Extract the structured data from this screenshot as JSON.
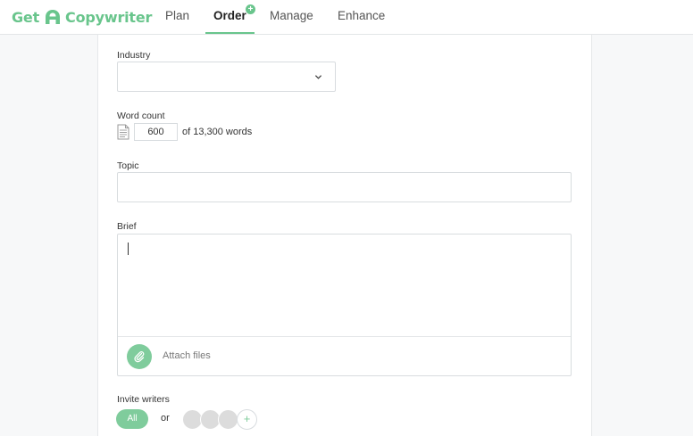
{
  "brand": {
    "name_part1": "Get",
    "name_part2": "Copywriter",
    "accent": "#69c58c"
  },
  "nav": {
    "plan": "Plan",
    "order": "Order",
    "order_badge": "+",
    "manage": "Manage",
    "enhance": "Enhance",
    "active": "Order"
  },
  "form": {
    "industry": {
      "label": "Industry",
      "value": ""
    },
    "word_count": {
      "label": "Word count",
      "value": "600",
      "suffix": "of 13,300 words"
    },
    "topic": {
      "label": "Topic",
      "value": ""
    },
    "brief": {
      "label": "Brief",
      "value": ""
    },
    "attach": {
      "label": "Attach files",
      "icon": "paperclip-icon"
    },
    "invite": {
      "label": "Invite writers",
      "all_label": "All",
      "or_label": "or",
      "add_symbol": "+"
    }
  }
}
